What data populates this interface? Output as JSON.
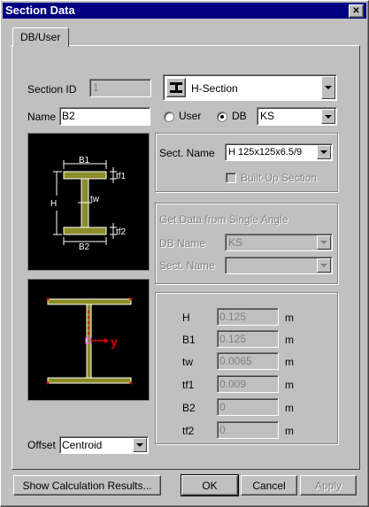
{
  "window": {
    "title": "Section Data",
    "close_glyph": "✕"
  },
  "tabs": [
    {
      "label": "DB/User"
    }
  ],
  "section_id": {
    "label": "Section ID",
    "value": "1"
  },
  "section_type": {
    "value": "H-Section"
  },
  "name": {
    "label": "Name",
    "value": "B2"
  },
  "source": {
    "user_label": "User",
    "db_label": "DB",
    "selected": "DB",
    "db_value": "KS"
  },
  "sect_name": {
    "label": "Sect. Name",
    "value": "H 125x125x6.5/9"
  },
  "built_up": {
    "label": "Built-Up Section",
    "checked": false
  },
  "angle_group": {
    "title": "Get Data from Single Angle",
    "db_name_label": "DB Name",
    "db_name_value": "KS",
    "sect_name_label": "Sect. Name",
    "sect_name_value": ""
  },
  "diagram": {
    "labels": {
      "b1": "B1",
      "b2": "B2",
      "tf1": "tf1",
      "tf2": "tf2",
      "tw": "tw",
      "h": "H"
    }
  },
  "centroid_view": {
    "axis_label": "y"
  },
  "dimensions": [
    {
      "label": "H",
      "value": "0.125",
      "unit": "m"
    },
    {
      "label": "B1",
      "value": "0.125",
      "unit": "m"
    },
    {
      "label": "tw",
      "value": "0.0065",
      "unit": "m"
    },
    {
      "label": "tf1",
      "value": "0.009",
      "unit": "m"
    },
    {
      "label": "B2",
      "value": "0",
      "unit": "m"
    },
    {
      "label": "tf2",
      "value": "0",
      "unit": "m"
    }
  ],
  "offset": {
    "label": "Offset",
    "value": "Centroid"
  },
  "buttons": {
    "calc": "Show Calculation Results...",
    "ok": "OK",
    "cancel": "Cancel",
    "apply": "Apply"
  },
  "colors": {
    "titlebar": "#000080",
    "section_fill": "#8c8c28",
    "axis_red": "#e00000"
  }
}
